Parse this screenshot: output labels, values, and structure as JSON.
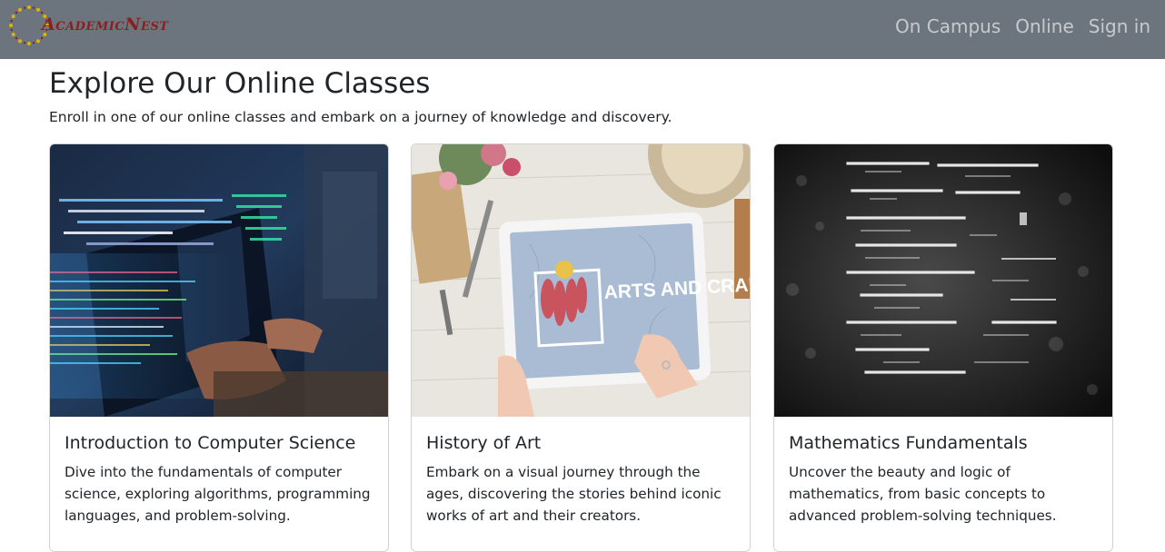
{
  "brand": {
    "name": "AcademicNest",
    "logo_icon": "wreath-of-stars-logo",
    "color": "#8b1e1e"
  },
  "nav": {
    "items": [
      "On Campus",
      "Online",
      "Sign in"
    ]
  },
  "main": {
    "title": "Explore Our Online Classes",
    "lead": "Enroll in one of our online classes and embark on a journey of knowledge and discovery."
  },
  "cards": [
    {
      "image": "programmer-coding-photo",
      "title": "Introduction to Computer Science",
      "text": "Dive into the fundamentals of computer science, exploring algorithms, programming languages, and problem-solving."
    },
    {
      "image": "arts-and-crafts-tablet-photo",
      "image_caption": "ARTS AND CRAFTS",
      "title": "History of Art",
      "text": "Embark on a visual journey through the ages, discovering the stories behind iconic works of art and their creators."
    },
    {
      "image": "math-formulas-photo",
      "title": "Mathematics Fundamentals",
      "text": "Uncover the beauty and logic of mathematics, from basic concepts to advanced problem-solving techniques."
    }
  ],
  "colors": {
    "navbar": "#6c757d",
    "nav_link": "rgba(255,255,255,0.62)",
    "text": "#212529"
  }
}
